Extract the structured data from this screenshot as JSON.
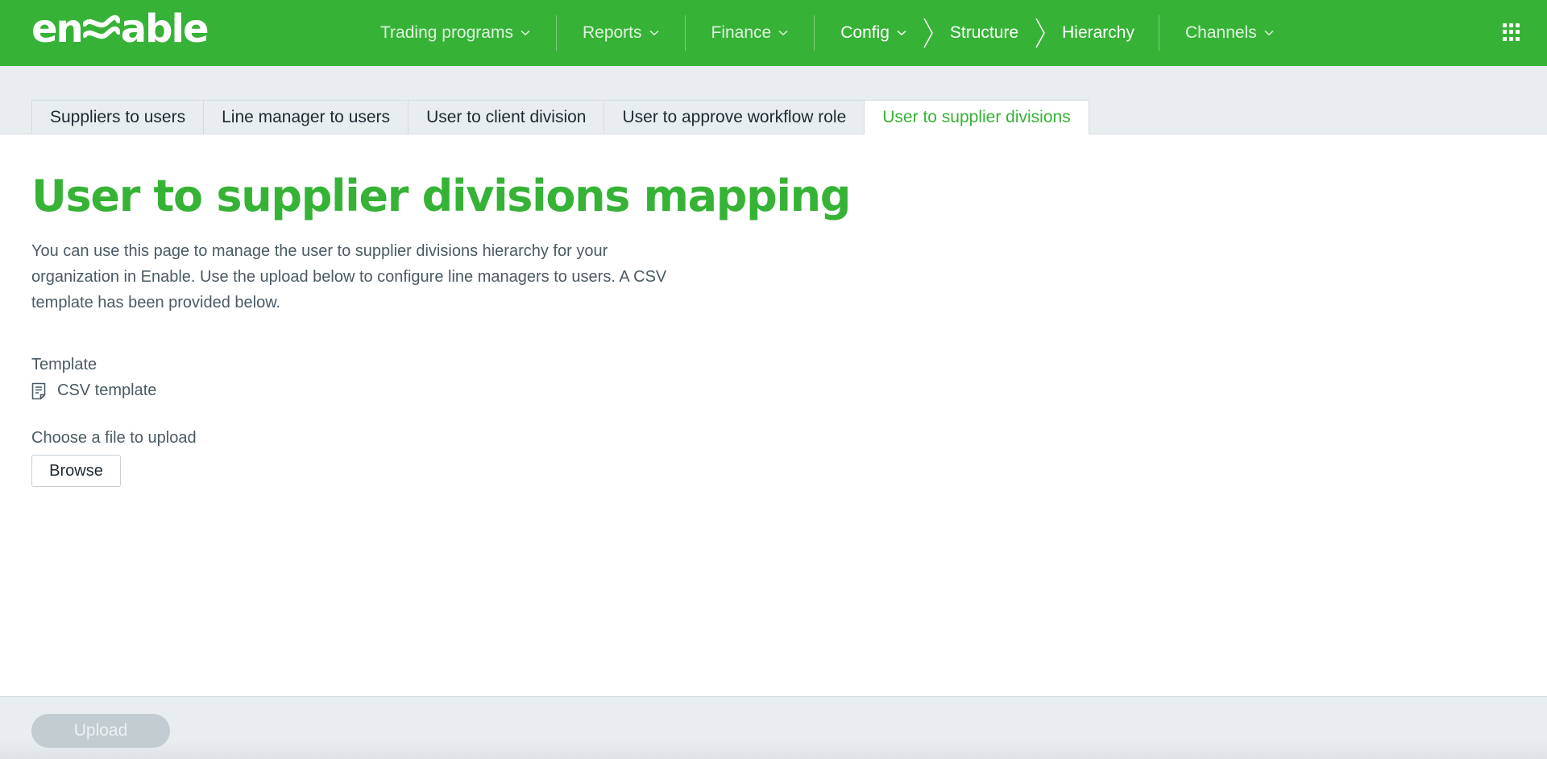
{
  "header": {
    "logo_text_left": "en",
    "logo_text_right": "able",
    "nav": {
      "trading_programs": "Trading programs",
      "reports": "Reports",
      "finance": "Finance",
      "config": "Config",
      "structure": "Structure",
      "hierarchy": "Hierarchy",
      "channels": "Channels"
    },
    "brand_color": "#36b336"
  },
  "tabs": [
    {
      "label": "Suppliers to users"
    },
    {
      "label": "Line manager to users"
    },
    {
      "label": "User to client division"
    },
    {
      "label": "User to approve workflow role"
    },
    {
      "label": "User to supplier divisions",
      "active": true
    }
  ],
  "main": {
    "title": "User to supplier divisions mapping",
    "description": "You can use this page to manage the user to supplier divisions hierarchy for your organization in Enable. Use the upload below to configure line managers to users. A CSV template has been provided below.",
    "template_label": "Template",
    "template_link": "CSV template",
    "template_icon": "document-icon",
    "choose_label": "Choose a file to upload",
    "browse_label": "Browse"
  },
  "footer": {
    "upload_label": "Upload",
    "upload_disabled": true
  }
}
